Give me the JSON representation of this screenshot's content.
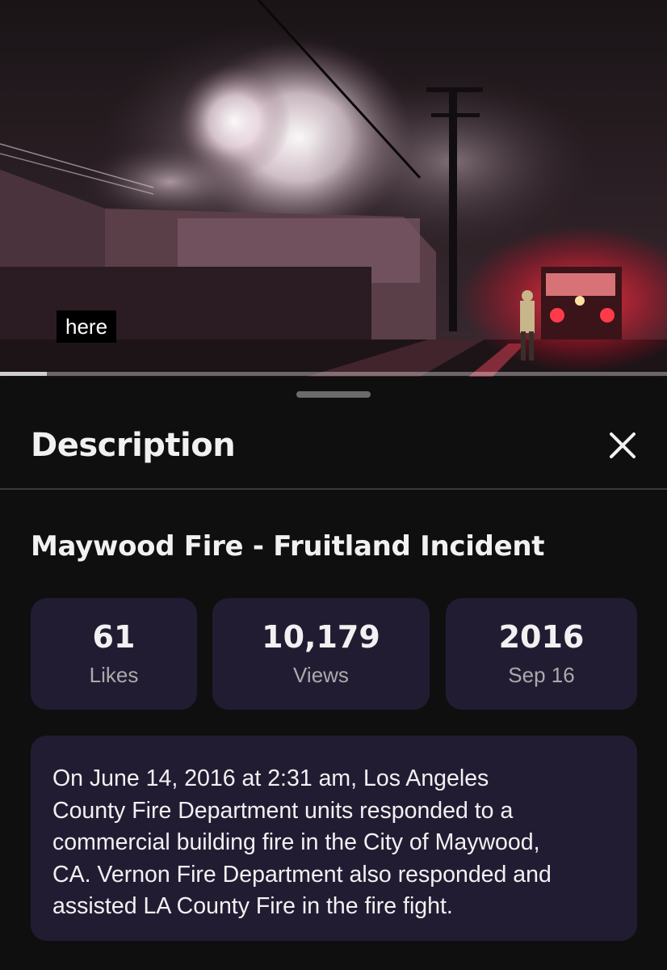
{
  "player": {
    "caption": "here",
    "progress_fraction": 0.07
  },
  "sheet": {
    "title": "Description",
    "close_icon": "close-icon"
  },
  "video": {
    "title": "Maywood Fire - Fruitland Incident",
    "stats": [
      {
        "value": "61",
        "label": "Likes"
      },
      {
        "value": "10,179",
        "label": "Views"
      },
      {
        "value": "2016",
        "label": "Sep 16"
      }
    ],
    "description": "On June 14, 2016 at 2:31 am, Los Angeles\nCounty Fire Department units responded to a\ncommercial building fire in the City of Maywood,\nCA. Vernon Fire Department also responded and\nassisted LA County Fire in the fire fight."
  },
  "colors": {
    "background": "#0f0f0f",
    "card": "#221c33",
    "text_primary": "#f1f1f1",
    "text_secondary": "#aaaaaa"
  }
}
